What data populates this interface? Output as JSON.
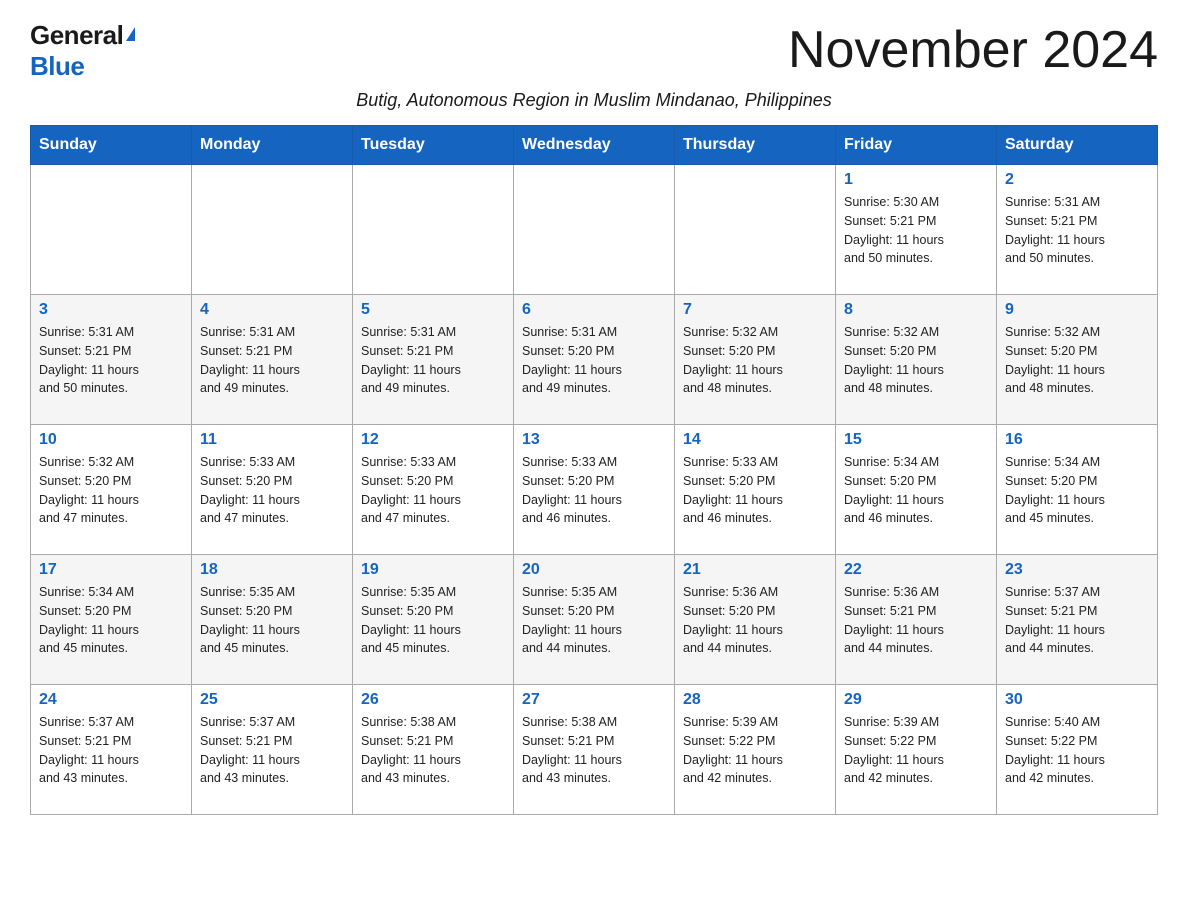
{
  "header": {
    "logo_general": "General",
    "logo_blue": "Blue",
    "month_title": "November 2024",
    "subtitle": "Butig, Autonomous Region in Muslim Mindanao, Philippines"
  },
  "days_of_week": [
    "Sunday",
    "Monday",
    "Tuesday",
    "Wednesday",
    "Thursday",
    "Friday",
    "Saturday"
  ],
  "weeks": [
    {
      "days": [
        {
          "date": "",
          "info": ""
        },
        {
          "date": "",
          "info": ""
        },
        {
          "date": "",
          "info": ""
        },
        {
          "date": "",
          "info": ""
        },
        {
          "date": "",
          "info": ""
        },
        {
          "date": "1",
          "info": "Sunrise: 5:30 AM\nSunset: 5:21 PM\nDaylight: 11 hours\nand 50 minutes."
        },
        {
          "date": "2",
          "info": "Sunrise: 5:31 AM\nSunset: 5:21 PM\nDaylight: 11 hours\nand 50 minutes."
        }
      ]
    },
    {
      "days": [
        {
          "date": "3",
          "info": "Sunrise: 5:31 AM\nSunset: 5:21 PM\nDaylight: 11 hours\nand 50 minutes."
        },
        {
          "date": "4",
          "info": "Sunrise: 5:31 AM\nSunset: 5:21 PM\nDaylight: 11 hours\nand 49 minutes."
        },
        {
          "date": "5",
          "info": "Sunrise: 5:31 AM\nSunset: 5:21 PM\nDaylight: 11 hours\nand 49 minutes."
        },
        {
          "date": "6",
          "info": "Sunrise: 5:31 AM\nSunset: 5:20 PM\nDaylight: 11 hours\nand 49 minutes."
        },
        {
          "date": "7",
          "info": "Sunrise: 5:32 AM\nSunset: 5:20 PM\nDaylight: 11 hours\nand 48 minutes."
        },
        {
          "date": "8",
          "info": "Sunrise: 5:32 AM\nSunset: 5:20 PM\nDaylight: 11 hours\nand 48 minutes."
        },
        {
          "date": "9",
          "info": "Sunrise: 5:32 AM\nSunset: 5:20 PM\nDaylight: 11 hours\nand 48 minutes."
        }
      ]
    },
    {
      "days": [
        {
          "date": "10",
          "info": "Sunrise: 5:32 AM\nSunset: 5:20 PM\nDaylight: 11 hours\nand 47 minutes."
        },
        {
          "date": "11",
          "info": "Sunrise: 5:33 AM\nSunset: 5:20 PM\nDaylight: 11 hours\nand 47 minutes."
        },
        {
          "date": "12",
          "info": "Sunrise: 5:33 AM\nSunset: 5:20 PM\nDaylight: 11 hours\nand 47 minutes."
        },
        {
          "date": "13",
          "info": "Sunrise: 5:33 AM\nSunset: 5:20 PM\nDaylight: 11 hours\nand 46 minutes."
        },
        {
          "date": "14",
          "info": "Sunrise: 5:33 AM\nSunset: 5:20 PM\nDaylight: 11 hours\nand 46 minutes."
        },
        {
          "date": "15",
          "info": "Sunrise: 5:34 AM\nSunset: 5:20 PM\nDaylight: 11 hours\nand 46 minutes."
        },
        {
          "date": "16",
          "info": "Sunrise: 5:34 AM\nSunset: 5:20 PM\nDaylight: 11 hours\nand 45 minutes."
        }
      ]
    },
    {
      "days": [
        {
          "date": "17",
          "info": "Sunrise: 5:34 AM\nSunset: 5:20 PM\nDaylight: 11 hours\nand 45 minutes."
        },
        {
          "date": "18",
          "info": "Sunrise: 5:35 AM\nSunset: 5:20 PM\nDaylight: 11 hours\nand 45 minutes."
        },
        {
          "date": "19",
          "info": "Sunrise: 5:35 AM\nSunset: 5:20 PM\nDaylight: 11 hours\nand 45 minutes."
        },
        {
          "date": "20",
          "info": "Sunrise: 5:35 AM\nSunset: 5:20 PM\nDaylight: 11 hours\nand 44 minutes."
        },
        {
          "date": "21",
          "info": "Sunrise: 5:36 AM\nSunset: 5:20 PM\nDaylight: 11 hours\nand 44 minutes."
        },
        {
          "date": "22",
          "info": "Sunrise: 5:36 AM\nSunset: 5:21 PM\nDaylight: 11 hours\nand 44 minutes."
        },
        {
          "date": "23",
          "info": "Sunrise: 5:37 AM\nSunset: 5:21 PM\nDaylight: 11 hours\nand 44 minutes."
        }
      ]
    },
    {
      "days": [
        {
          "date": "24",
          "info": "Sunrise: 5:37 AM\nSunset: 5:21 PM\nDaylight: 11 hours\nand 43 minutes."
        },
        {
          "date": "25",
          "info": "Sunrise: 5:37 AM\nSunset: 5:21 PM\nDaylight: 11 hours\nand 43 minutes."
        },
        {
          "date": "26",
          "info": "Sunrise: 5:38 AM\nSunset: 5:21 PM\nDaylight: 11 hours\nand 43 minutes."
        },
        {
          "date": "27",
          "info": "Sunrise: 5:38 AM\nSunset: 5:21 PM\nDaylight: 11 hours\nand 43 minutes."
        },
        {
          "date": "28",
          "info": "Sunrise: 5:39 AM\nSunset: 5:22 PM\nDaylight: 11 hours\nand 42 minutes."
        },
        {
          "date": "29",
          "info": "Sunrise: 5:39 AM\nSunset: 5:22 PM\nDaylight: 11 hours\nand 42 minutes."
        },
        {
          "date": "30",
          "info": "Sunrise: 5:40 AM\nSunset: 5:22 PM\nDaylight: 11 hours\nand 42 minutes."
        }
      ]
    }
  ]
}
